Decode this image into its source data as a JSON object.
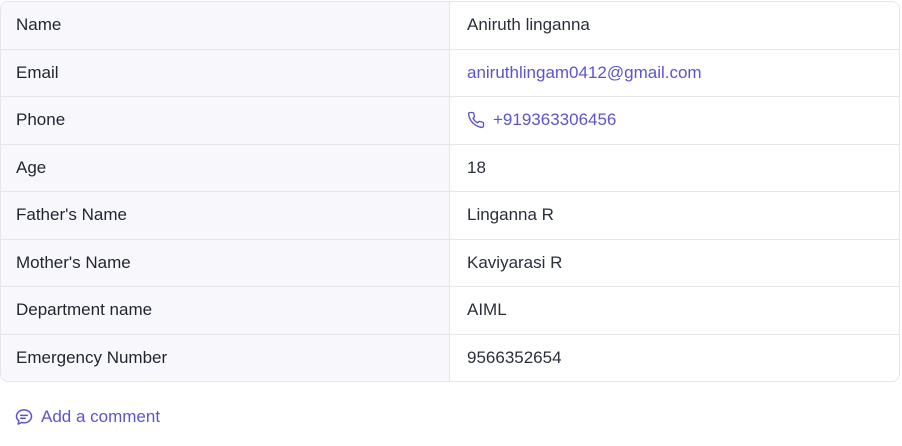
{
  "details": {
    "rows": [
      {
        "label": "Name",
        "value": "Aniruth linganna"
      },
      {
        "label": "Email",
        "value": "aniruthlingam0412@gmail.com"
      },
      {
        "label": "Phone",
        "value": "+919363306456"
      },
      {
        "label": "Age",
        "value": "18"
      },
      {
        "label": "Father's Name",
        "value": "Linganna R"
      },
      {
        "label": "Mother's Name",
        "value": "Kaviyarasi R"
      },
      {
        "label": "Department name",
        "value": "AIML"
      },
      {
        "label": "Emergency Number",
        "value": "9566352654"
      }
    ]
  },
  "actions": {
    "add_comment_label": "Add a comment"
  },
  "icons": {
    "phone": "phone-icon",
    "comment": "comment-icon"
  },
  "colors": {
    "accent": "#5b53d6",
    "label_bg": "#f8f8fc",
    "border": "#e4e6ec"
  }
}
